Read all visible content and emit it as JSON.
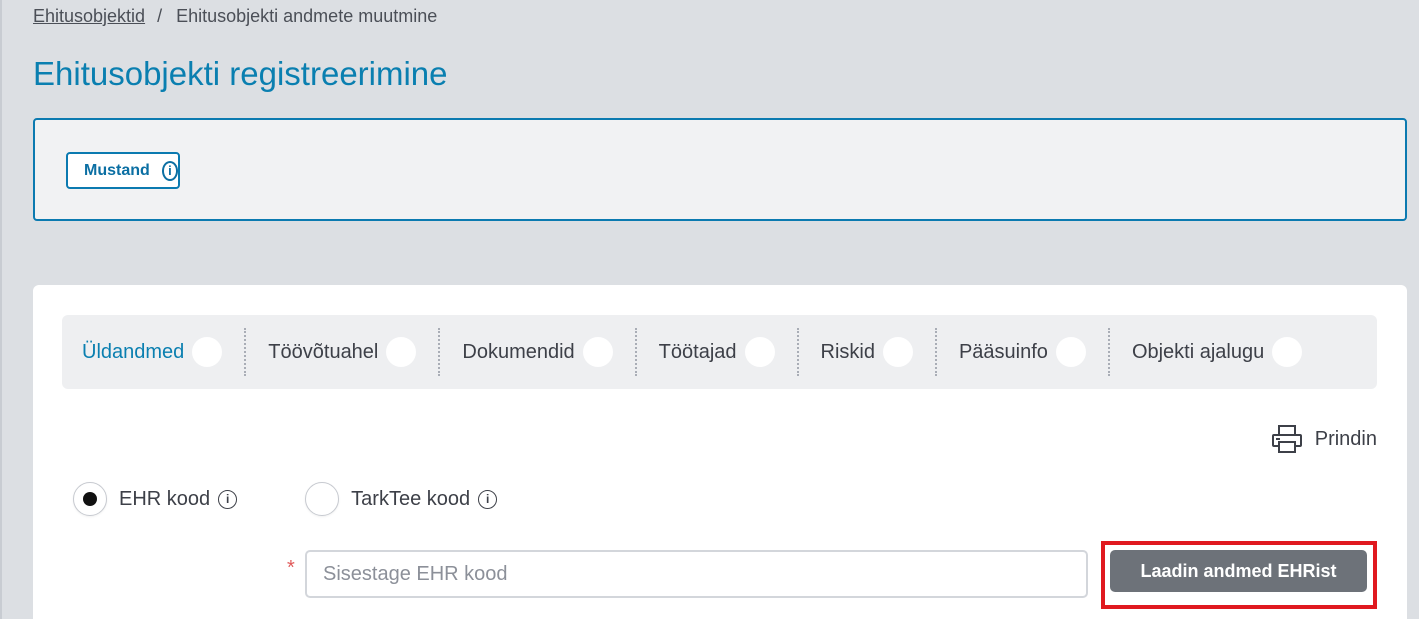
{
  "breadcrumb": {
    "parent": "Ehitusobjektid",
    "separator": "/",
    "current": "Ehitusobjekti andmete muutmine"
  },
  "page": {
    "title": "Ehitusobjekti registreerimine"
  },
  "status": {
    "label": "Mustand",
    "info_icon": "info-icon"
  },
  "tabs": [
    {
      "label": "Üldandmed",
      "active": true
    },
    {
      "label": "Töövõtuahel"
    },
    {
      "label": "Dokumendid"
    },
    {
      "label": "Töötajad"
    },
    {
      "label": "Riskid"
    },
    {
      "label": "Pääsuinfo"
    },
    {
      "label": "Objekti ajalugu"
    }
  ],
  "print": {
    "label": "Prindin",
    "icon": "printer-icon"
  },
  "code_type": {
    "options": [
      {
        "label": "EHR kood",
        "selected": true
      },
      {
        "label": "TarkTee kood",
        "selected": false
      }
    ]
  },
  "ehr_field": {
    "required_mark": "*",
    "placeholder": "Sisestage EHR kood",
    "value": ""
  },
  "load_button": {
    "label": "Laadin andmed EHRist"
  },
  "colors": {
    "accent": "#0a7fb0",
    "highlight": "#e0191f",
    "button": "#6d7279",
    "background": "#dcdfe3"
  }
}
